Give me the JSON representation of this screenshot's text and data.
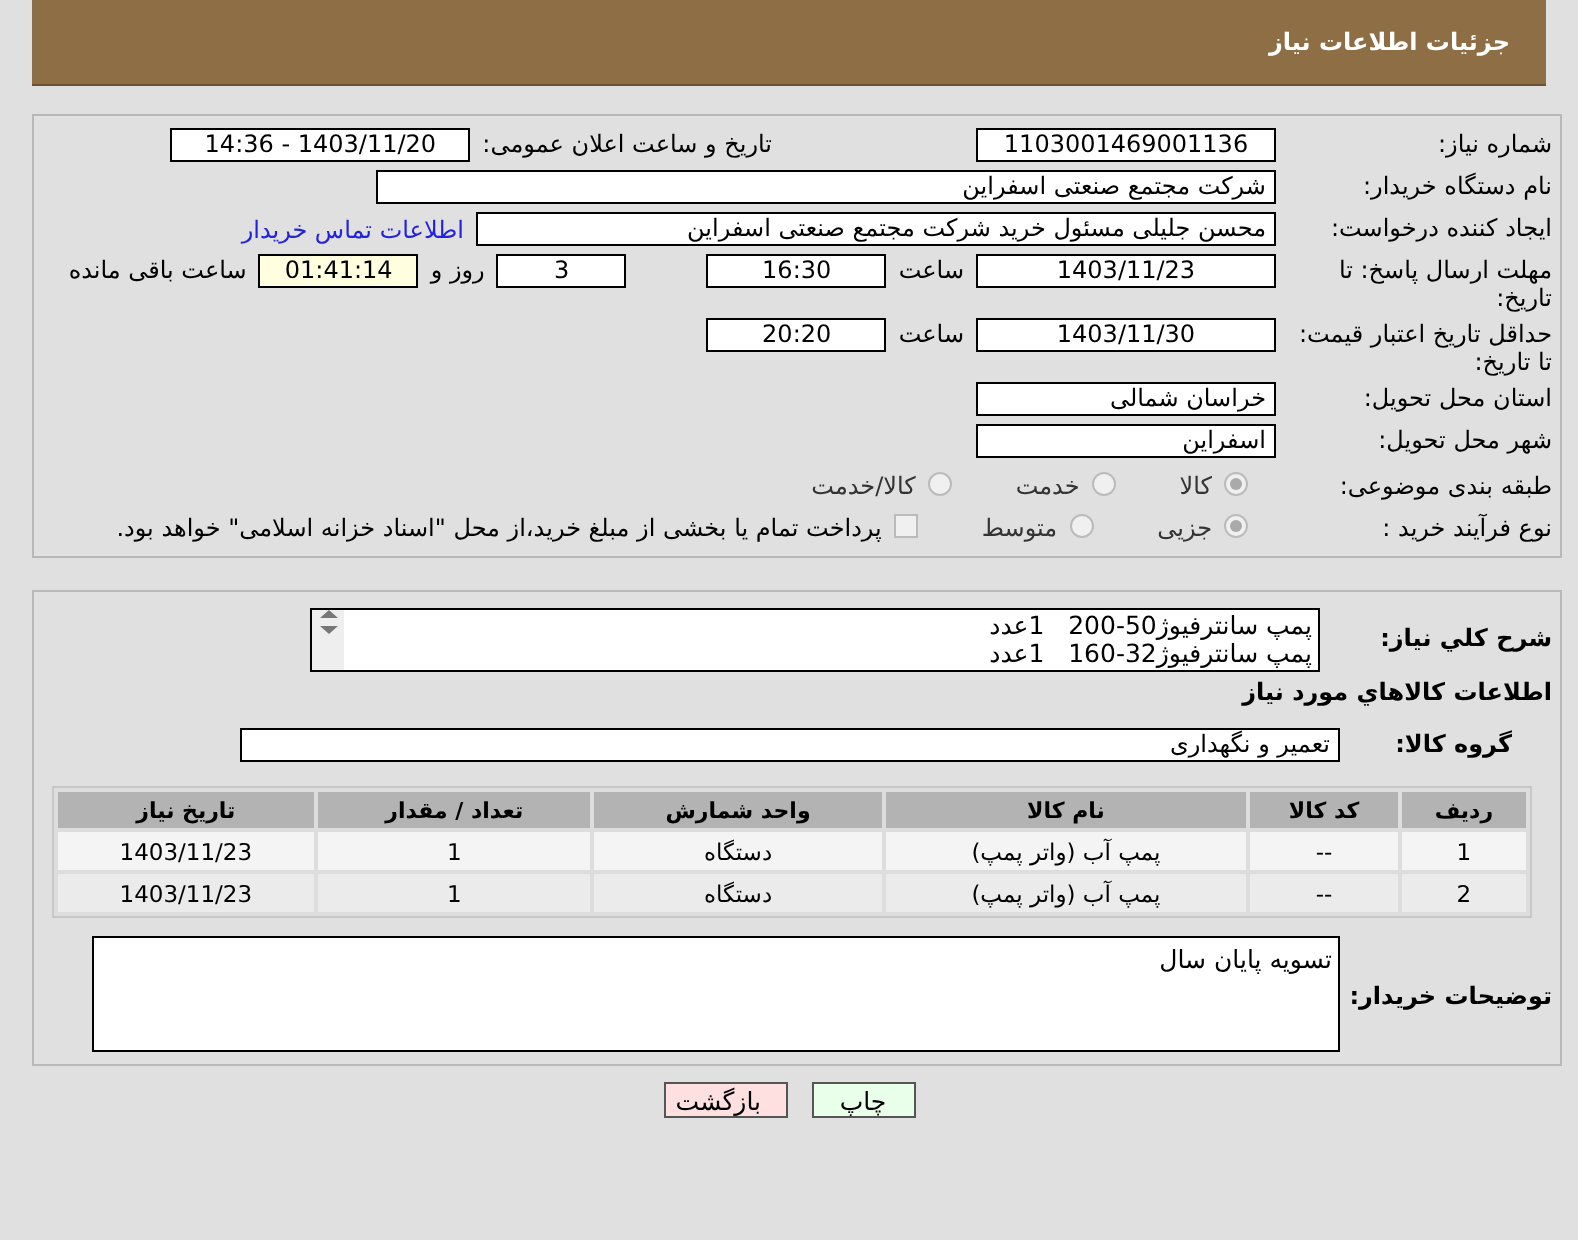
{
  "header": {
    "title": "جزئیات اطلاعات نیاز"
  },
  "need_number": {
    "label": "شماره نیاز:",
    "value": "1103001469001136"
  },
  "announce": {
    "label": "تاریخ و ساعت اعلان عمومی:",
    "value": "1403/11/20 - 14:36"
  },
  "buyer_org": {
    "label": "نام دستگاه خریدار:",
    "value": "شرکت مجتمع صنعتی اسفراین"
  },
  "requester": {
    "label": "ایجاد کننده درخواست:",
    "value": "محسن جلیلی مسئول خرید شرکت مجتمع صنعتی اسفراین",
    "link": "اطلاعات تماس خریدار"
  },
  "reply_deadline": {
    "label": "مهلت ارسال پاسخ: تا تاریخ:",
    "date": "1403/11/23",
    "time_label": "ساعت",
    "time": "16:30",
    "days": "3",
    "days_label": "روز و",
    "remaining": "01:41:14",
    "remaining_label": "ساعت باقی مانده"
  },
  "price_validity": {
    "label": "حداقل تاریخ اعتبار قیمت: تا تاریخ:",
    "date": "1403/11/30",
    "time_label": "ساعت",
    "time": "20:20"
  },
  "province": {
    "label": "استان محل تحویل:",
    "value": "خراسان شمالی"
  },
  "city": {
    "label": "شهر محل تحویل:",
    "value": "اسفراین"
  },
  "category": {
    "label": "طبقه بندی موضوعی:",
    "options": [
      {
        "label": "کالا",
        "selected": true
      },
      {
        "label": "خدمت",
        "selected": false
      },
      {
        "label": "کالا/خدمت",
        "selected": false
      }
    ]
  },
  "process": {
    "label": "نوع فرآیند خرید :",
    "options": [
      {
        "label": "جزیی",
        "selected": true
      },
      {
        "label": "متوسط",
        "selected": false
      }
    ],
    "payment": {
      "label": "پرداخت تمام یا بخشی از مبلغ خرید،از محل \"اسناد خزانه اسلامی\" خواهد بود.",
      "checked": false
    }
  },
  "description": {
    "label": "شرح کلي نياز:",
    "lines": [
      "پمپ سانترفیوژ50-200   1عدد",
      "پمپ سانترفیوژ32-160   1عدد"
    ]
  },
  "goods_heading": "اطلاعات کالاهاي مورد نياز",
  "goods_group": {
    "label": "گروه کالا:",
    "value": "تعمیر و نگهداری"
  },
  "table": {
    "columns": [
      "ردیف",
      "کد کالا",
      "نام کالا",
      "واحد شمارش",
      "تعداد / مقدار",
      "تاریخ نیاز"
    ],
    "rows": [
      [
        "1",
        "--",
        "پمپ آب (واتر پمپ)",
        "دستگاه",
        "1",
        "1403/11/23"
      ],
      [
        "2",
        "--",
        "پمپ آب (واتر پمپ)",
        "دستگاه",
        "1",
        "1403/11/23"
      ]
    ]
  },
  "buyer_notes": {
    "label": "توضیحات خریدار:",
    "value": "تسویه پایان سال"
  },
  "buttons": [
    {
      "label": "چاپ",
      "kind": "print"
    },
    {
      "label": "بازگشت",
      "kind": "back"
    }
  ]
}
